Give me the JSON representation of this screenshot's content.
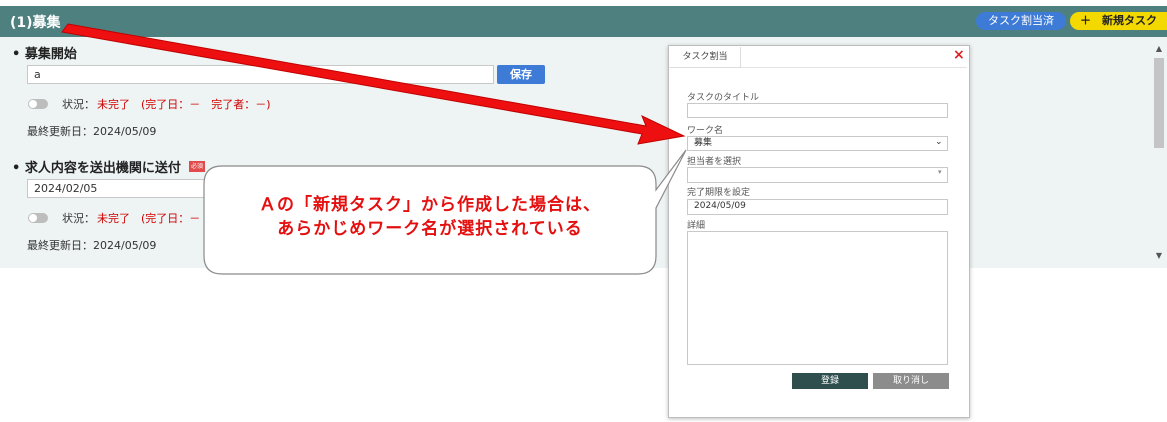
{
  "header": {
    "section_title": "(1)募集",
    "assigned_button": "タスク割当済",
    "new_task_button": "＋　新規タスク"
  },
  "tasks": [
    {
      "title": "募集開始",
      "input_value": "a",
      "save_label": "保存",
      "status_label": "状況：",
      "status_value": "未完了　(完了日：－　完了者：－)",
      "updated": "最終更新日：2024/05/09"
    },
    {
      "title": "求人内容を送出機関に送付",
      "required_badge": "必須",
      "input_value": "2024/02/05",
      "status_label": "状況：",
      "status_value": "未完了　(完了日：－",
      "updated": "最終更新日：2024/05/09"
    }
  ],
  "modal": {
    "tab_label": "タスク割当",
    "close_icon": "×",
    "title_label": "タスクのタイトル",
    "title_value": "",
    "work_label": "ワーク名",
    "work_value": "募集",
    "assignee_label": "担当者を選択",
    "assignee_value": "",
    "due_label": "完了期限を設定",
    "due_value": "2024/05/09",
    "details_label": "詳細",
    "details_value": "",
    "register_label": "登録",
    "cancel_label": "取り消し"
  },
  "callout": {
    "line1": "Ａの「新規タスク」から作成した場合は、",
    "line2": "あらかじめワーク名が選択されている"
  },
  "colors": {
    "header_bg": "#4e8080",
    "accent_blue": "#3d7bd6",
    "new_task_yellow": "#f4d900",
    "status_red": "#d00000",
    "annotation_red": "#e41010"
  },
  "icons": [
    "toggle-icon",
    "chevron-down-icon",
    "close-icon",
    "scroll-up-icon",
    "scroll-down-icon"
  ]
}
